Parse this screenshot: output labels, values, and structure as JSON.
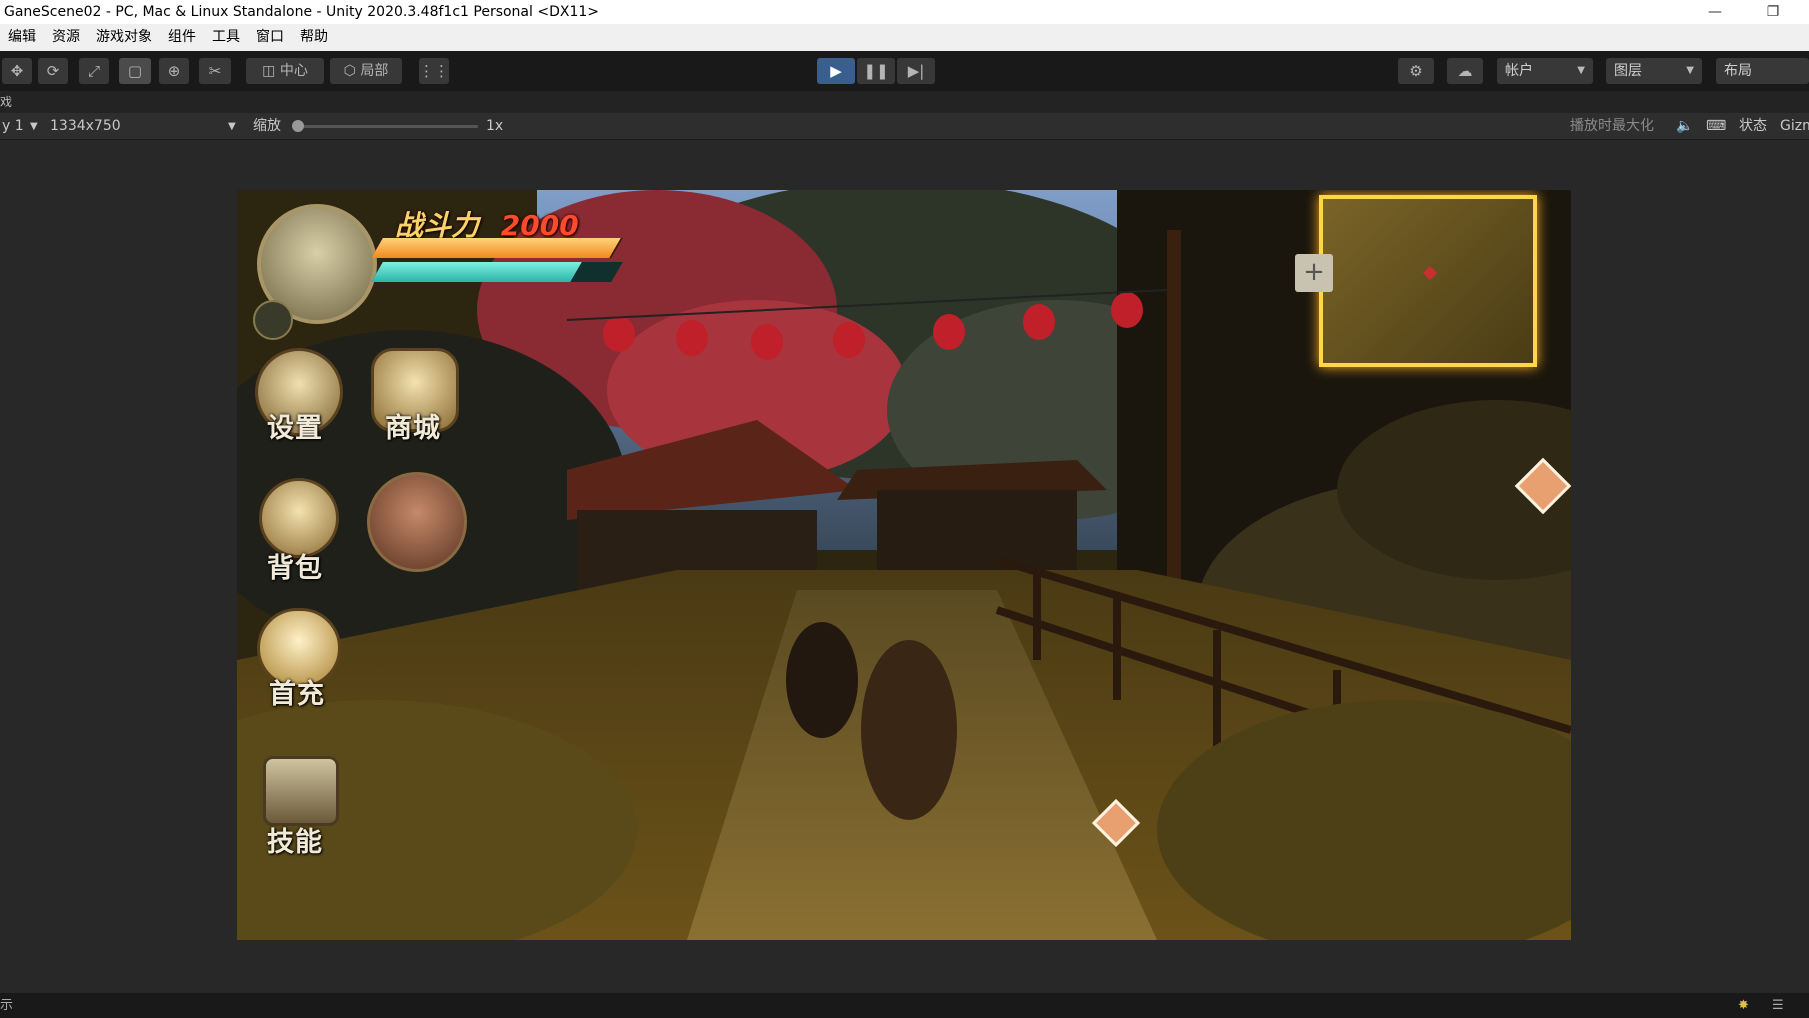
{
  "window": {
    "title": "GaneScene02 - PC, Mac & Linux Standalone - Unity 2020.3.48f1c1 Personal <DX11>",
    "minimize_glyph": "—",
    "restore_glyph": "❐"
  },
  "menu": [
    "编辑",
    "资源",
    "游戏对象",
    "组件",
    "工具",
    "窗口",
    "帮助"
  ],
  "toolbar": {
    "pivot_label": "中心",
    "space_label": "局部",
    "account_label": "帐户",
    "layers_label": "图层",
    "layout_label": "布局"
  },
  "tab_row": {
    "label": "戏"
  },
  "game_view": {
    "display_label": "y 1",
    "resolution": "1334x750",
    "scale_label": "缩放",
    "scale_value": "1x",
    "maximize_label": "播放时最大化",
    "stats_label": "状态",
    "gizmos_label": "Gizm"
  },
  "hud": {
    "combat_power_label": "战斗力",
    "combat_power_value": "2000",
    "health_fill": 0.99,
    "mana_fill": 0.83,
    "menu_items": {
      "settings": "设置",
      "shop": "商城",
      "bag": "背包",
      "first_charge": "首充",
      "skills": "技能"
    }
  },
  "status_bar": {
    "text": "示"
  },
  "colors": {
    "play_accent": "#3a5f8f",
    "minimap_border": "#ffd54a",
    "hp_bar": "#f08a1e",
    "mp_bar": "#2bb5a8",
    "combat_number": "#ff4a2c"
  }
}
